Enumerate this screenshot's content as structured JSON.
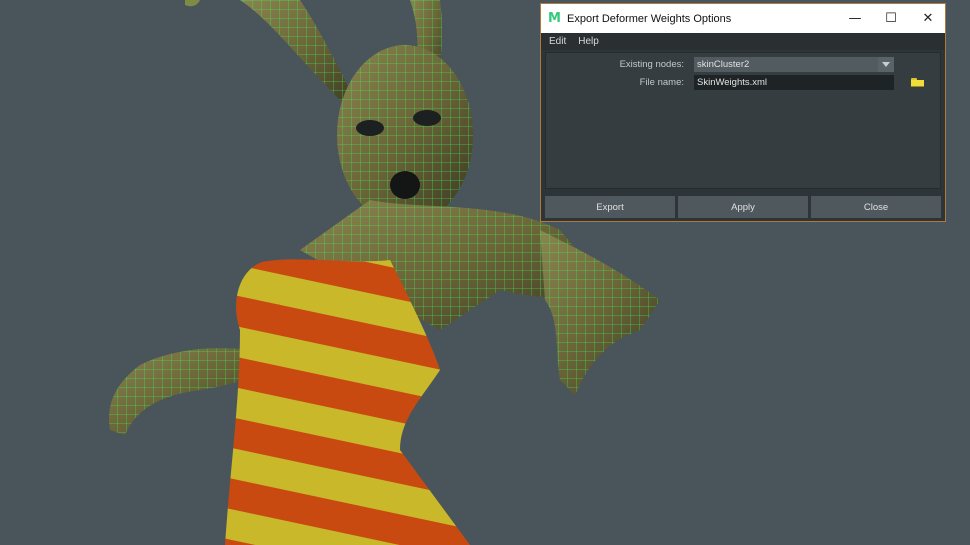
{
  "viewport": {
    "background": "#4a555b",
    "wireframe_color": "#3df05a",
    "skin_color": "#6e6a3e",
    "stripe_colors": [
      "#c94a10",
      "#c8b82a"
    ]
  },
  "dialog": {
    "title": "Export Deformer Weights Options",
    "app_icon": "M",
    "accent_border": "#b07a3c",
    "window_controls": {
      "minimize": "—",
      "maximize": "☐",
      "close": "✕"
    },
    "menu": [
      "Edit",
      "Help"
    ],
    "fields": {
      "existing_nodes": {
        "label": "Existing nodes:",
        "value": "skinCluster2"
      },
      "file_name": {
        "label": "File name:",
        "value": "SkinWeights.xml"
      }
    },
    "buttons": {
      "export": "Export",
      "apply": "Apply",
      "close": "Close"
    }
  }
}
